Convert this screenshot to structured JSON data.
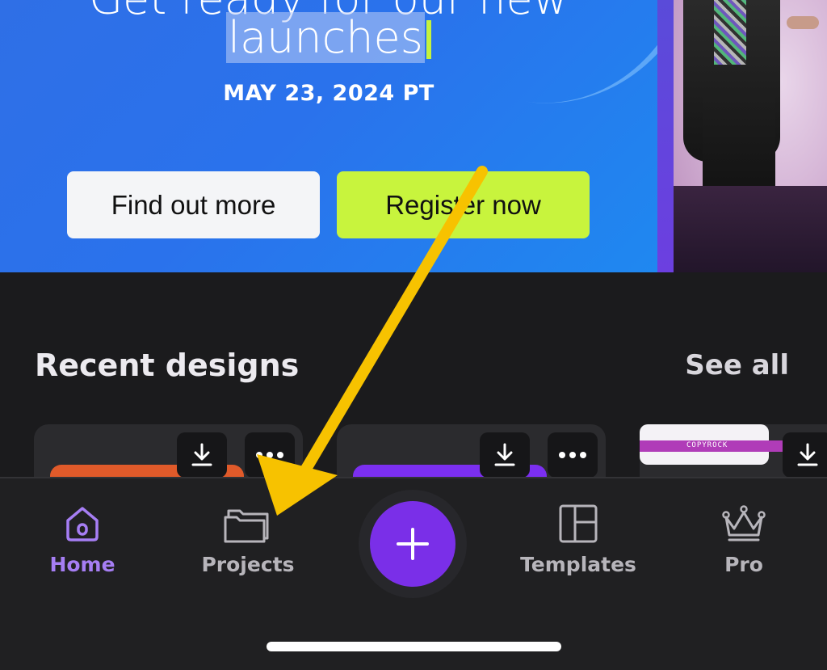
{
  "banner": {
    "headline_line1": "Get ready for our new",
    "headline_line2": "launches",
    "date": "MAY 23, 2024 PT",
    "find_out_more": "Find out more",
    "register_now": "Register now"
  },
  "recent": {
    "title": "Recent designs",
    "see_all": "See all",
    "card3_thumb_text": "COPYROCK"
  },
  "nav": {
    "home": "Home",
    "projects": "Projects",
    "templates": "Templates",
    "pro": "Pro",
    "active": "Home"
  },
  "colors": {
    "accent": "#7a2fe8",
    "active_nav": "#a67ef4",
    "register_button": "#c8f43d",
    "banner_blue": "#2a72ec",
    "annotation_arrow": "#f7c200"
  },
  "icons": {
    "home": "home-icon",
    "projects": "folder-icon",
    "create": "plus-icon",
    "templates": "layout-icon",
    "pro": "crown-icon",
    "download": "download-icon",
    "more": "more-dots-icon"
  }
}
